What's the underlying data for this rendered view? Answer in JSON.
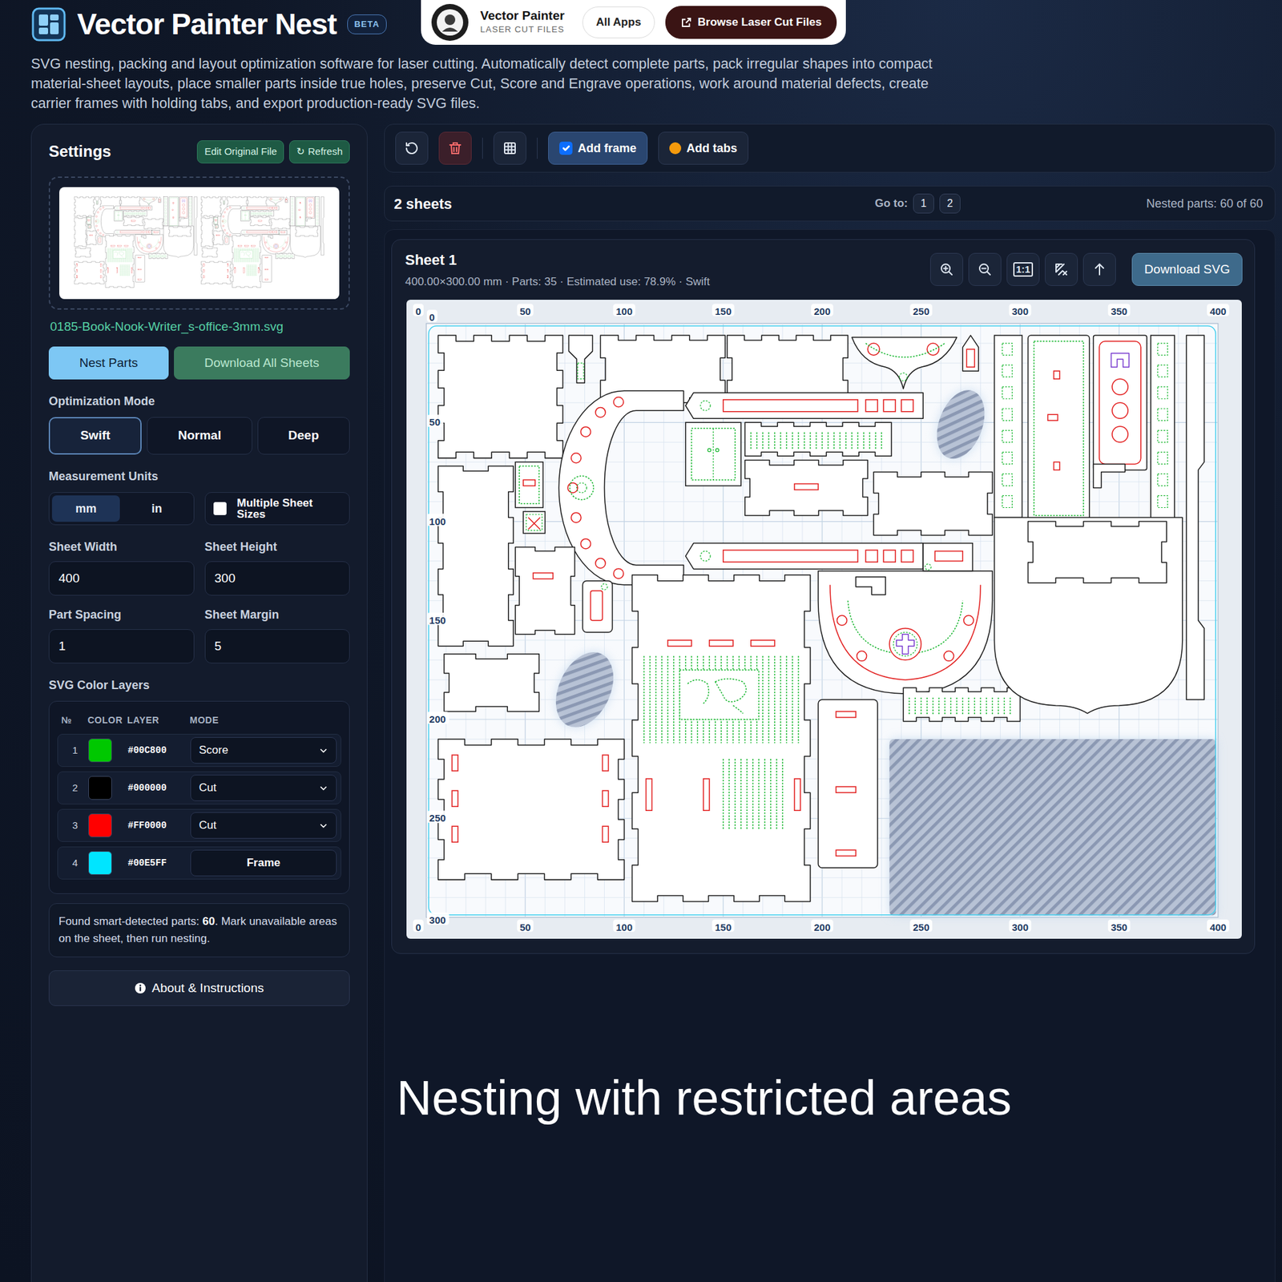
{
  "app": {
    "title": "Vector Painter Nest",
    "badge": "BETA",
    "description": "SVG nesting, packing and layout optimization software for laser cutting. Automatically detect complete parts, pack irregular shapes into compact material-sheet layouts, place smaller parts inside true holes, preserve Cut, Score and Engrave operations, work around material defects, create carrier frames with holding tabs, and export production-ready SVG files."
  },
  "brand": {
    "name": "Vector Painter",
    "tagline": "LASER CUT FILES",
    "all_apps": "All Apps",
    "browse": "Browse Laser Cut Files"
  },
  "settings": {
    "title": "Settings",
    "edit_button": "Edit Original File",
    "refresh_icon": "↻",
    "refresh_button": "Refresh",
    "file_name": "0185-Book-Nook-Writer_s-office-3mm.svg",
    "nest_button": "Nest Parts",
    "download_all_button": "Download All Sheets",
    "optimization_label": "Optimization Mode",
    "modes": [
      {
        "label": "Swift",
        "selected": true
      },
      {
        "label": "Normal",
        "selected": false
      },
      {
        "label": "Deep",
        "selected": false
      }
    ],
    "units_label": "Measurement Units",
    "units": [
      {
        "label": "mm",
        "selected": true
      },
      {
        "label": "in",
        "selected": false
      }
    ],
    "multiple_sizes": {
      "label": "Multiple Sheet Sizes",
      "checked": false
    },
    "fields": [
      {
        "label": "Sheet Width",
        "value": "400"
      },
      {
        "label": "Sheet Height",
        "value": "300"
      },
      {
        "label": "Part Spacing",
        "value": "1"
      },
      {
        "label": "Sheet Margin",
        "value": "5"
      }
    ],
    "layers_label": "SVG Color Layers",
    "layers_columns": [
      "№",
      "COLOR",
      "LAYER",
      "MODE"
    ],
    "layers": [
      {
        "index": "1",
        "color": "#00C800",
        "code": "#00C800",
        "mode": "Score",
        "kind": "select"
      },
      {
        "index": "2",
        "color": "#000000",
        "code": "#000000",
        "mode": "Cut",
        "kind": "select"
      },
      {
        "index": "3",
        "color": "#FF0000",
        "code": "#FF0000",
        "mode": "Cut",
        "kind": "select"
      },
      {
        "index": "4",
        "color": "#00E5FF",
        "code": "#00E5FF",
        "mode": "Frame",
        "kind": "button"
      }
    ],
    "info": {
      "before": "Found smart-detected parts: ",
      "count": "60",
      "after": ". Mark unavailable areas on the sheet, then run nesting."
    },
    "about_button": "About & Instructions"
  },
  "toolbar": {
    "add_frame": {
      "label": "Add frame",
      "checked": true
    },
    "add_tabs": {
      "label": "Add tabs",
      "on": true
    }
  },
  "sheets_bar": {
    "count": "2 sheets",
    "goto_label": "Go to:",
    "pages": [
      "1",
      "2"
    ],
    "nested": "Nested parts: 60 of 60"
  },
  "sheet": {
    "title": "Sheet 1",
    "meta": "400.00×300.00 mm · Parts: 35 · Estimated use: 78.9% · Swift",
    "zoom_reset": "1:1",
    "download_button": "Download SVG",
    "ruler": {
      "top": [
        "0",
        "50",
        "100",
        "150",
        "200",
        "250",
        "300",
        "350",
        "400"
      ],
      "bottom": [
        "0",
        "50",
        "100",
        "150",
        "200",
        "250",
        "300",
        "350",
        "400"
      ],
      "left": [
        "0",
        "50",
        "100",
        "150",
        "200",
        "250",
        "300"
      ]
    }
  },
  "caption": "Nesting with restricted areas"
}
